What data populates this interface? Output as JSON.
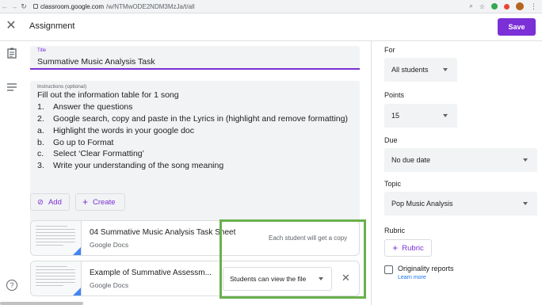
{
  "browser": {
    "url_host": "classroom.google.com",
    "url_path": "/w/NTMwODE2NDM3MzJa/t/all"
  },
  "header": {
    "title": "Assignment",
    "save_label": "Save"
  },
  "form": {
    "title_label": "Title",
    "title_value": "Summative Music Analysis Task",
    "instructions_label": "Instructions (optional)",
    "instructions": [
      {
        "num": "",
        "text": "Fill out the information table for 1 song"
      },
      {
        "num": "1.",
        "text": "Answer the questions"
      },
      {
        "num": "2.",
        "text": "Google search, copy and paste in the Lyrics in (highlight and remove formatting)"
      },
      {
        "num": "a.",
        "text": "Highlight the words in your google doc"
      },
      {
        "num": "b.",
        "text": "Go up to Format"
      },
      {
        "num": "c.",
        "text": "Select ‘Clear Formatting’"
      },
      {
        "num": "3.",
        "text": "Write your understanding of the song meaning"
      }
    ],
    "add_label": "Add",
    "create_label": "Create"
  },
  "attachments": [
    {
      "name": "04 Summative Music Analysis Task Sheet",
      "type": "Google Docs",
      "share": "Each student will get a copy"
    },
    {
      "name": "Example of Summative Assessm...",
      "type": "Google Docs",
      "share": "Students can view the file"
    }
  ],
  "side": {
    "for_label": "For",
    "for_value": "All students",
    "points_label": "Points",
    "points_value": "15",
    "due_label": "Due",
    "due_value": "No due date",
    "topic_label": "Topic",
    "topic_value": "Pop Music Analysis",
    "rubric_label": "Rubric",
    "rubric_button": "Rubric",
    "originality_label": "Originality reports",
    "learn_more": "Learn more"
  },
  "colors": {
    "accent": "#7b2fd6",
    "highlight_box": "#6ab04c",
    "docs_blue": "#4285f4"
  }
}
